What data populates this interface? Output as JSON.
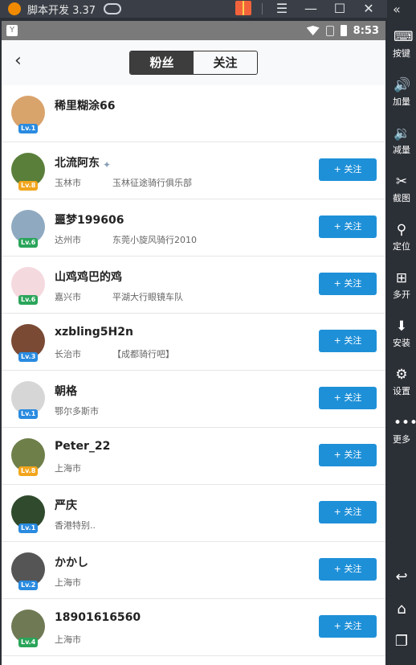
{
  "emulator": {
    "title": "脚本开发 3.37",
    "sidebar": [
      {
        "label": "按键",
        "icon": "keyboard-icon"
      },
      {
        "label": "加量",
        "icon": "volume-up-icon"
      },
      {
        "label": "减量",
        "icon": "volume-down-icon"
      },
      {
        "label": "截图",
        "icon": "scissors-icon"
      },
      {
        "label": "定位",
        "icon": "location-icon"
      },
      {
        "label": "多开",
        "icon": "multi-window-icon"
      },
      {
        "label": "安装",
        "icon": "apk-icon"
      },
      {
        "label": "设置",
        "icon": "gear-icon"
      },
      {
        "label": "更多",
        "icon": "more-icon"
      }
    ]
  },
  "statusbar": {
    "time": "8:53"
  },
  "tabs": [
    {
      "label": "粉丝",
      "active": true
    },
    {
      "label": "关注",
      "active": false
    }
  ],
  "follow_label": "+ 关注",
  "users": [
    {
      "name": "稀里糊涂66",
      "city": "",
      "club": "",
      "level": "Lv.1",
      "level_color": "#2a8be0",
      "avatar_color": "#d9a36c",
      "has_follow": false
    },
    {
      "name": "北流阿东",
      "city": "玉林市",
      "club": "玉林征途骑行俱乐部",
      "level": "Lv.8",
      "level_color": "#f2a51c",
      "avatar_color": "#5a7f3a",
      "has_follow": true,
      "has_badge": true
    },
    {
      "name": "噩梦199606",
      "city": "达州市",
      "club": "东莞小旋风骑行2010",
      "level": "Lv.6",
      "level_color": "#2aa55a",
      "avatar_color": "#8fa9c0",
      "has_follow": true
    },
    {
      "name": "山鸡鸡巴的鸡",
      "city": "嘉兴市",
      "club": "平湖大行眼镜车队",
      "level": "Lv.6",
      "level_color": "#2aa55a",
      "avatar_color": "#f4d9df",
      "has_follow": true
    },
    {
      "name": "xzbling5H2n",
      "city": "长治市",
      "club": "【成都骑行吧】",
      "level": "Lv.3",
      "level_color": "#2a8be0",
      "avatar_color": "#7a4a35",
      "has_follow": true
    },
    {
      "name": "朝格",
      "city": "鄂尔多斯市",
      "club": "",
      "level": "Lv.1",
      "level_color": "#2a8be0",
      "avatar_color": "#d6d6d6",
      "has_follow": true
    },
    {
      "name": "Peter_22",
      "city": "上海市",
      "club": "",
      "level": "Lv.8",
      "level_color": "#f2a51c",
      "avatar_color": "#6e7f4a",
      "has_follow": true
    },
    {
      "name": "严庆",
      "city": "香港特别..",
      "club": "",
      "level": "Lv.1",
      "level_color": "#2a8be0",
      "avatar_color": "#2f4a2c",
      "has_follow": true
    },
    {
      "name": "かかし",
      "city": "上海市",
      "club": "",
      "level": "Lv.2",
      "level_color": "#2a8be0",
      "avatar_color": "#555555",
      "has_follow": true
    },
    {
      "name": "18901616560",
      "city": "上海市",
      "club": "",
      "level": "Lv.4",
      "level_color": "#2aa55a",
      "avatar_color": "#6f7a55",
      "has_follow": true
    }
  ]
}
